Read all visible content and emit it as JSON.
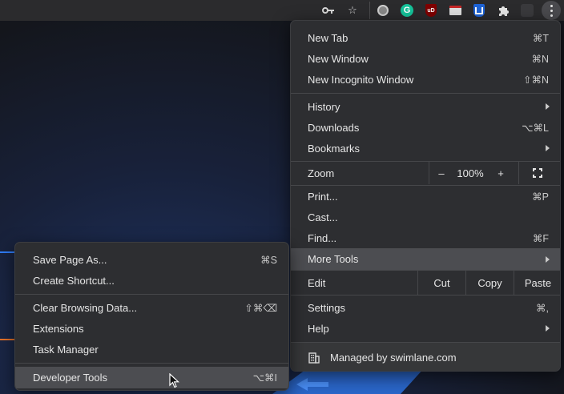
{
  "toolbar": {
    "icons": [
      "key-icon",
      "star-icon",
      "extension-circle-icon",
      "grammarly-icon",
      "ublock-icon",
      "extension-window-icon",
      "extension-shield-icon",
      "puzzle-icon",
      "profile-avatar",
      "kebab-menu-icon"
    ],
    "grammarly_letter": "G",
    "ublock_text": "uD"
  },
  "main_menu": {
    "new_tab": {
      "label": "New Tab",
      "shortcut": "⌘T"
    },
    "new_window": {
      "label": "New Window",
      "shortcut": "⌘N"
    },
    "new_incognito": {
      "label": "New Incognito Window",
      "shortcut": "⇧⌘N"
    },
    "history": {
      "label": "History"
    },
    "downloads": {
      "label": "Downloads",
      "shortcut": "⌥⌘L"
    },
    "bookmarks": {
      "label": "Bookmarks"
    },
    "zoom": {
      "label": "Zoom",
      "minus": "–",
      "level": "100%",
      "plus": "+"
    },
    "print": {
      "label": "Print...",
      "shortcut": "⌘P"
    },
    "cast": {
      "label": "Cast..."
    },
    "find": {
      "label": "Find...",
      "shortcut": "⌘F"
    },
    "more_tools": {
      "label": "More Tools"
    },
    "edit": {
      "label": "Edit",
      "cut": "Cut",
      "copy": "Copy",
      "paste": "Paste"
    },
    "settings": {
      "label": "Settings",
      "shortcut": "⌘,"
    },
    "help": {
      "label": "Help"
    },
    "managed": {
      "label": "Managed by swimlane.com"
    }
  },
  "sub_menu": {
    "save_page": {
      "label": "Save Page As...",
      "shortcut": "⌘S"
    },
    "create_shortcut": {
      "label": "Create Shortcut..."
    },
    "clear_data": {
      "label": "Clear Browsing Data...",
      "shortcut": "⇧⌘⌫"
    },
    "extensions": {
      "label": "Extensions"
    },
    "task_manager": {
      "label": "Task Manager"
    },
    "dev_tools": {
      "label": "Developer Tools",
      "shortcut": "⌥⌘I"
    }
  },
  "colors": {
    "menu_bg": "#2d2e31",
    "highlight": "#4c4d51",
    "accent_blue": "#2f7cf6",
    "accent_orange": "#e8742a"
  }
}
